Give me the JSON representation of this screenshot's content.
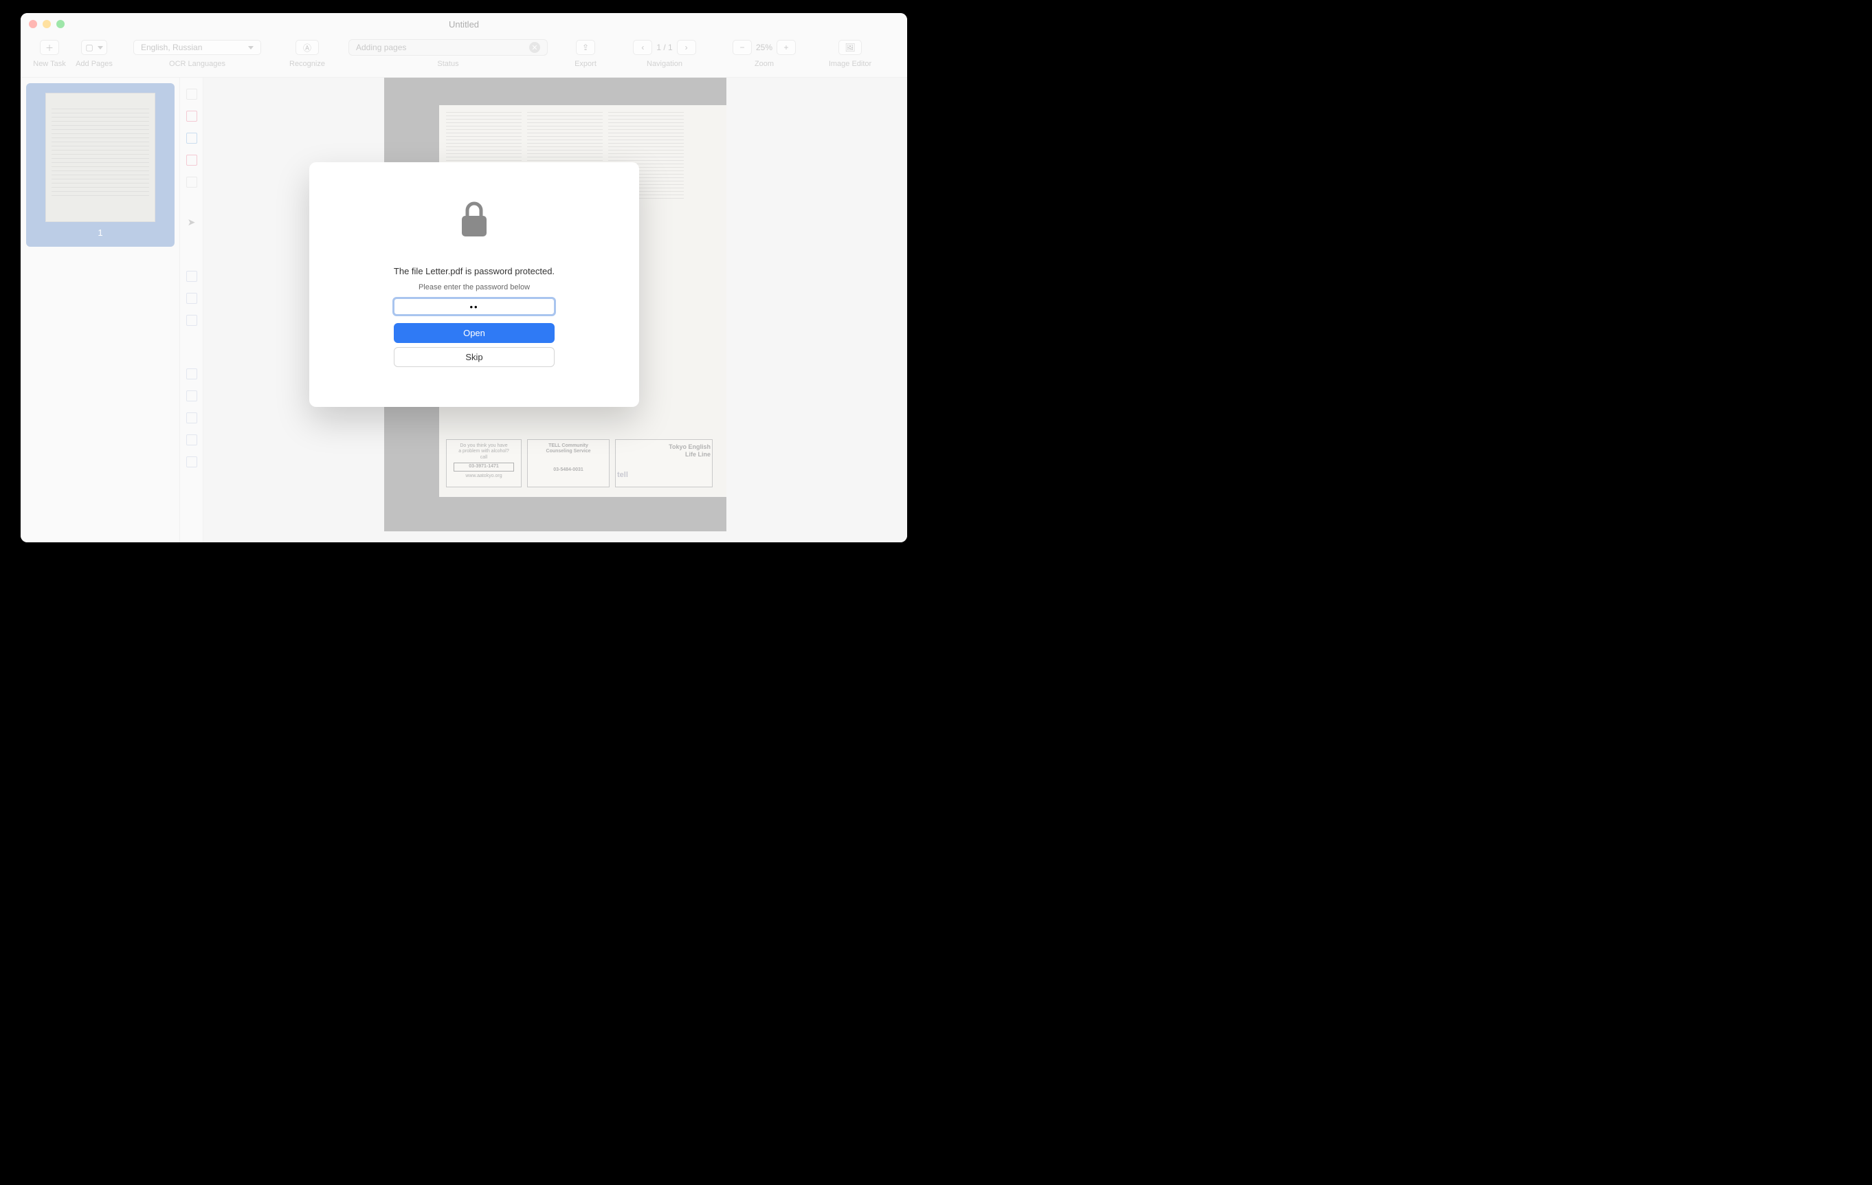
{
  "window": {
    "title": "Untitled"
  },
  "toolbar": {
    "new_task": "New Task",
    "add_pages": "Add Pages",
    "ocr_languages_label": "OCR Languages",
    "ocr_languages_value": "English, Russian",
    "recognize": "Recognize",
    "status_label": "Status",
    "status_value": "Adding pages",
    "export": "Export",
    "navigation_label": "Navigation",
    "navigation_value": "1 / 1",
    "zoom_label": "Zoom",
    "zoom_value": "25%",
    "image_editor": "Image Editor"
  },
  "sidebar": {
    "thumb_number": "1"
  },
  "document": {
    "ads": {
      "a1_l1": "Do you think you have",
      "a1_l2": "a problem with alcohol?",
      "a1_l3": "call",
      "a1_l4": "03-3971-1471",
      "a1_l5": "www.aatokyo.org",
      "a2_l1": "TELL Community",
      "a2_l2": "Counseling Service",
      "a2_l3": "03-5484-0031",
      "a3_l1": "Tokyo English",
      "a3_l2": "Life Line",
      "a3_l3": "tell"
    }
  },
  "modal": {
    "message": "The file Letter.pdf is password protected.",
    "sub": "Please enter the password below",
    "password_value": "••",
    "open": "Open",
    "skip": "Skip"
  }
}
